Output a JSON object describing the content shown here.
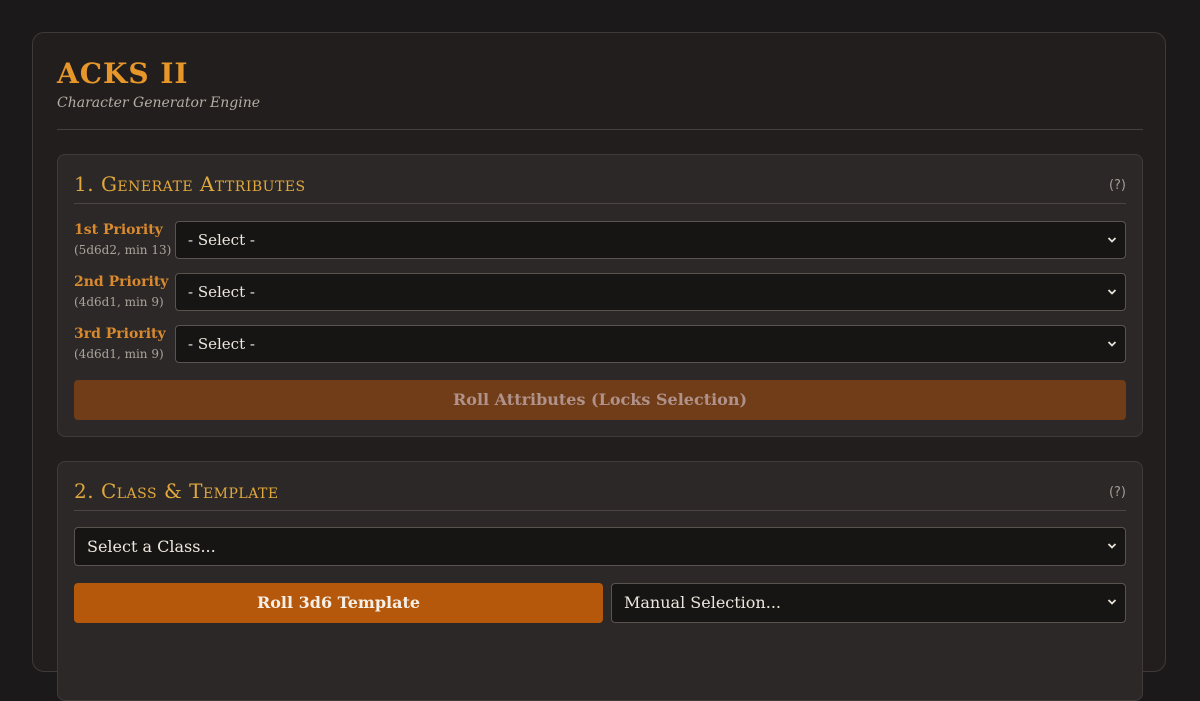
{
  "app": {
    "title": "ACKS II",
    "subtitle": "Character Generator Engine"
  },
  "attributes_section": {
    "title": "1. Generate Attributes",
    "help": "(?)",
    "priorities": [
      {
        "label": "1st Priority",
        "note": "(5d6d2, min 13)",
        "selected": "- Select -"
      },
      {
        "label": "2nd Priority",
        "note": "(4d6d1, min 9)",
        "selected": "- Select -"
      },
      {
        "label": "3rd Priority",
        "note": "(4d6d1, min 9)",
        "selected": "- Select -"
      }
    ],
    "roll_button": "Roll Attributes (Locks Selection)"
  },
  "class_section": {
    "title": "2. Class & Template",
    "help": "(?)",
    "class_select": "Select a Class...",
    "roll_template_button": "Roll 3d6 Template",
    "manual_select": "Manual Selection..."
  },
  "colors": {
    "accent": "#e7962a",
    "section_title": "#e0a83c",
    "button_active": "#b6580c",
    "button_disabled": "#703d18",
    "background": "#1b1919",
    "panel": "#2c2827"
  }
}
